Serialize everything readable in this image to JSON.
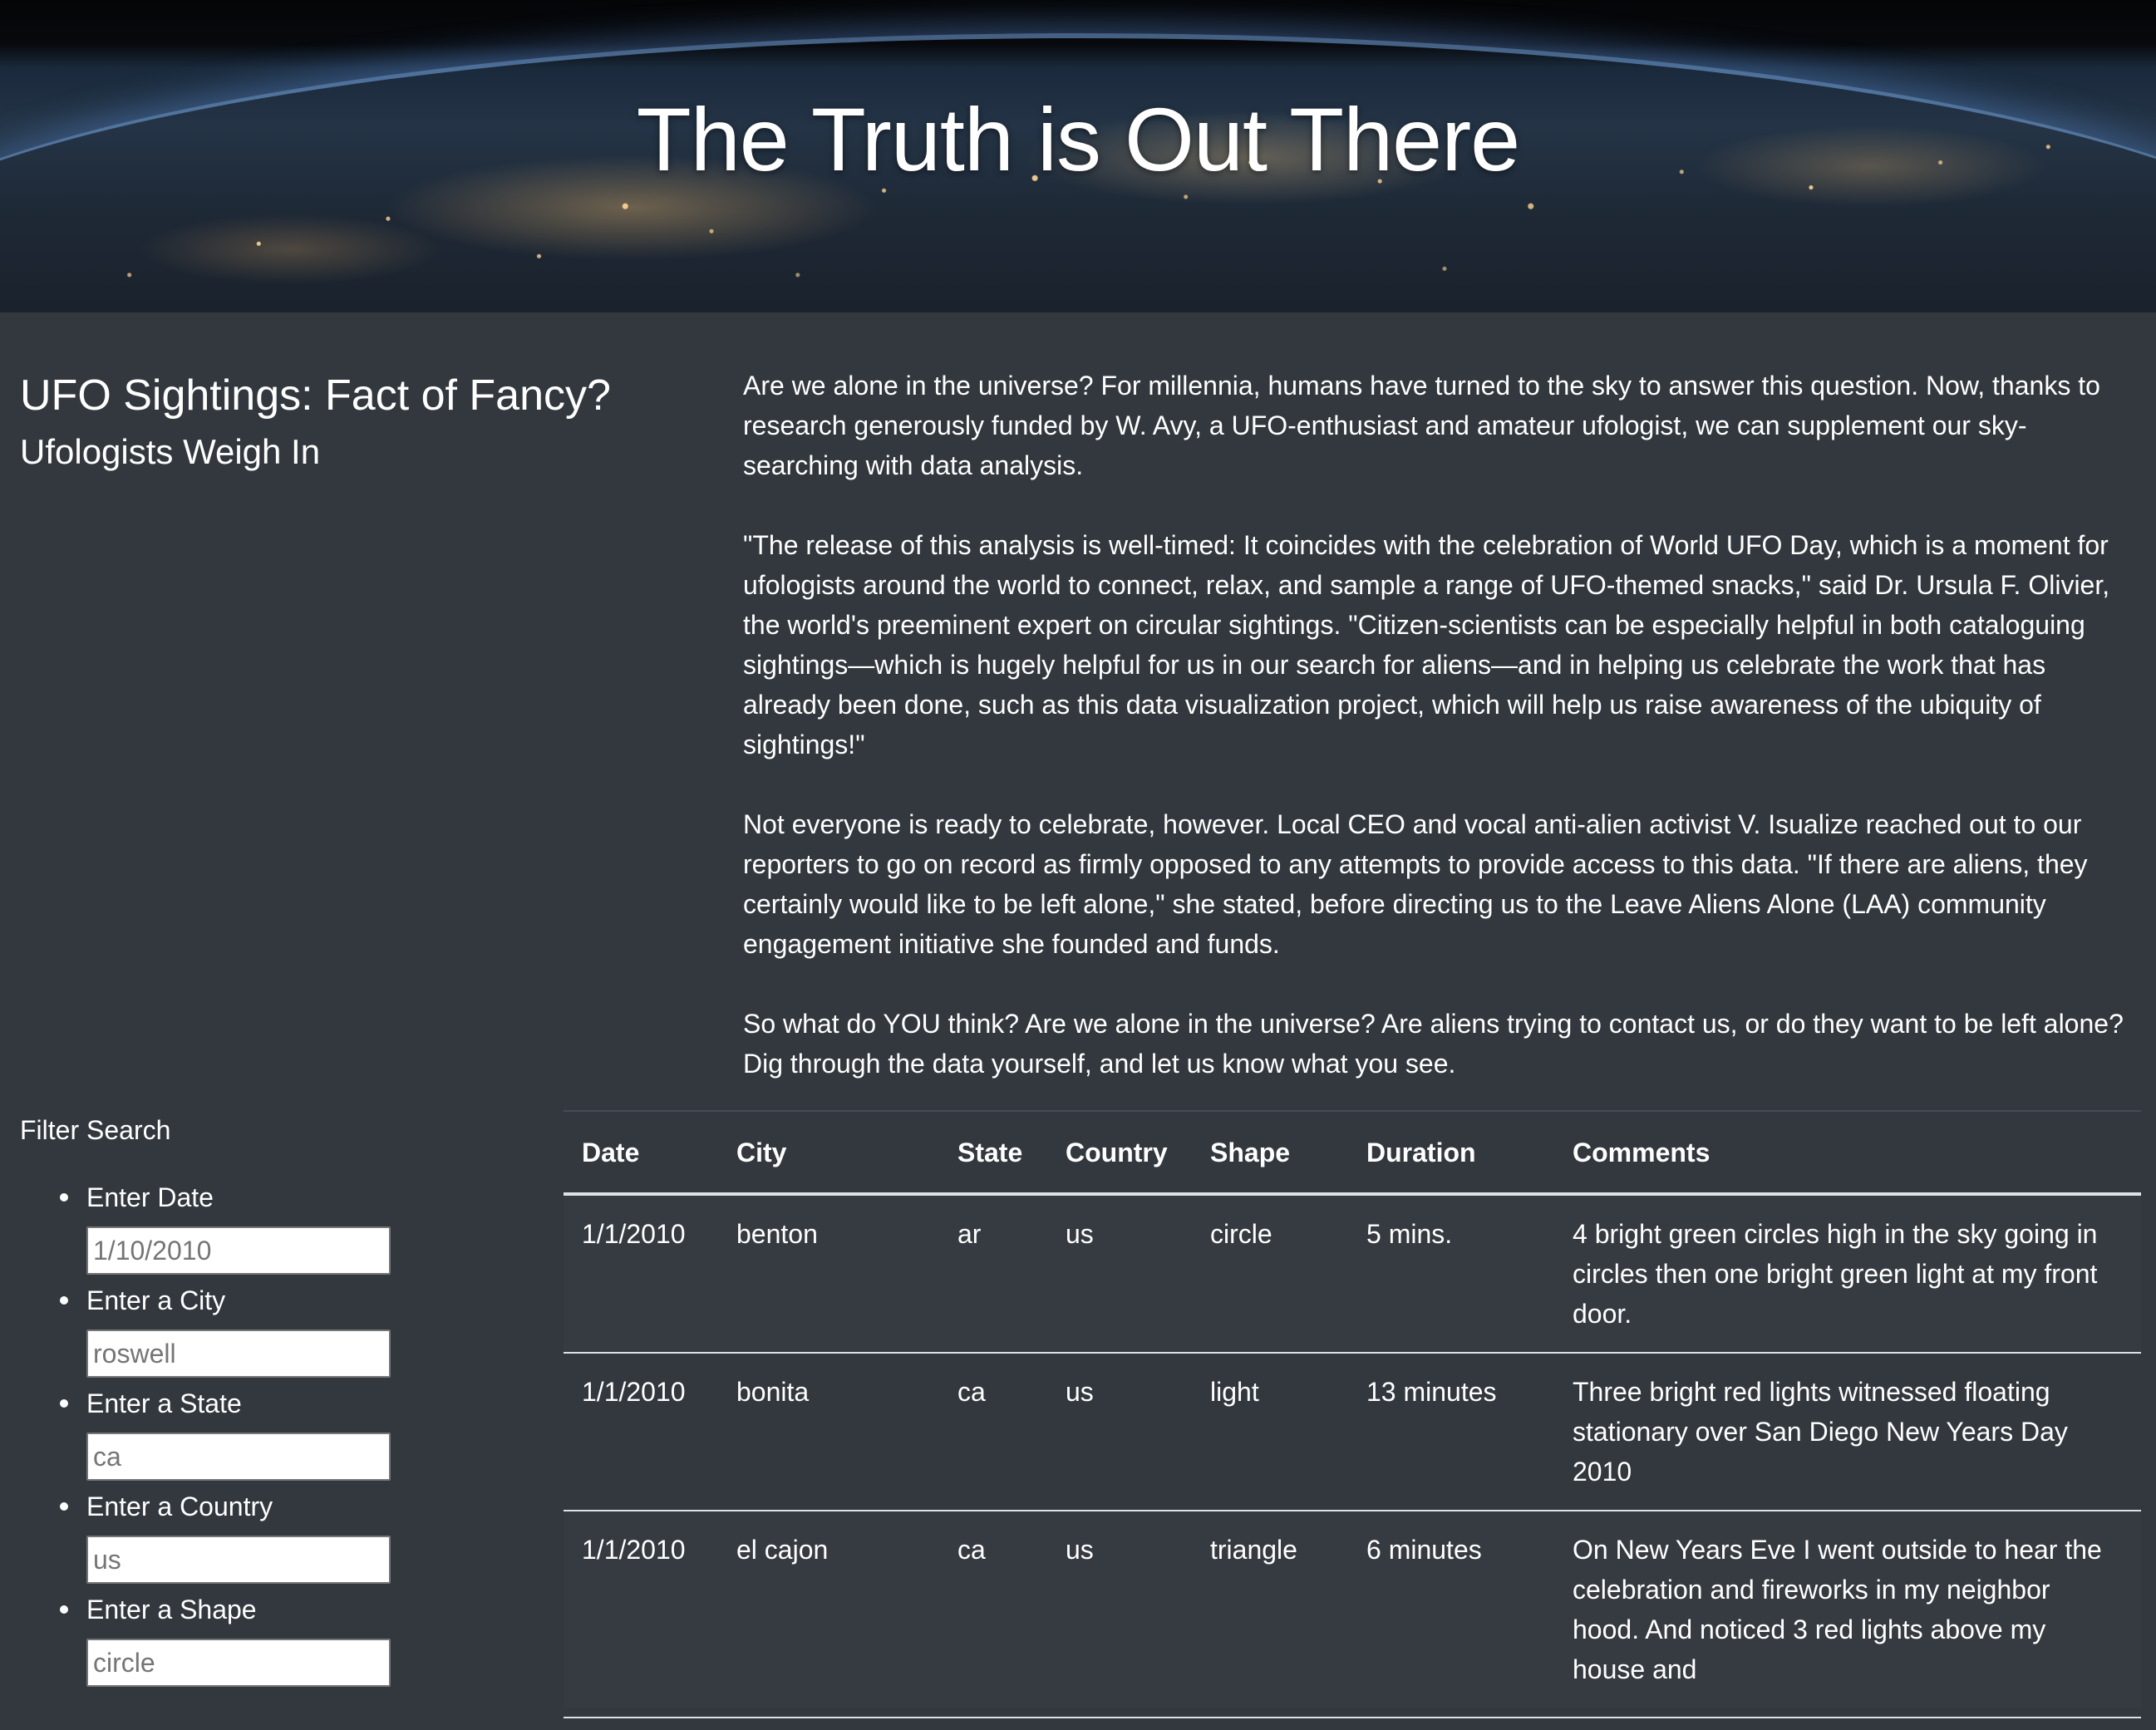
{
  "hero": {
    "title": "The Truth is Out There"
  },
  "intro": {
    "headline": "UFO Sightings: Fact of Fancy?",
    "subheadline": "Ufologists Weigh In"
  },
  "article": {
    "paragraphs": [
      "Are we alone in the universe? For millennia, humans have turned to the sky to answer this question. Now, thanks to research generously funded by W. Avy, a UFO-enthusiast and amateur ufologist, we can supplement our sky-searching with data analysis.",
      "\"The release of this analysis is well-timed: It coincides with the celebration of World UFO Day, which is a moment for ufologists around the world to connect, relax, and sample a range of UFO-themed snacks,\" said Dr. Ursula F. Olivier, the world's preeminent expert on circular sightings. \"Citizen-scientists can be especially helpful in both cataloguing sightings—which is hugely helpful for us in our search for aliens—and in helping us celebrate the work that has already been done, such as this data visualization project, which will help us raise awareness of the ubiquity of sightings!\"",
      "Not everyone is ready to celebrate, however. Local CEO and vocal anti-alien activist V. Isualize reached out to our reporters to go on record as firmly opposed to any attempts to provide access to this data. \"If there are aliens, they certainly would like to be left alone,\" she stated, before directing us to the Leave Aliens Alone (LAA) community engagement initiative she founded and funds.",
      "So what do YOU think? Are we alone in the universe? Are aliens trying to contact us, or do they want to be left alone? Dig through the data yourself, and let us know what you see."
    ]
  },
  "filters": {
    "title": "Filter Search",
    "items": [
      {
        "label": "Enter Date",
        "placeholder": "1/10/2010",
        "value": ""
      },
      {
        "label": "Enter a City",
        "placeholder": "roswell",
        "value": ""
      },
      {
        "label": "Enter a State",
        "placeholder": "ca",
        "value": ""
      },
      {
        "label": "Enter a Country",
        "placeholder": "us",
        "value": ""
      },
      {
        "label": "Enter a Shape",
        "placeholder": "circle",
        "value": ""
      }
    ]
  },
  "table": {
    "columns": [
      "Date",
      "City",
      "State",
      "Country",
      "Shape",
      "Duration",
      "Comments"
    ],
    "rows": [
      [
        "1/1/2010",
        "benton",
        "ar",
        "us",
        "circle",
        "5 mins.",
        "4 bright green circles high in the sky going in circles then one bright green light at my front door."
      ],
      [
        "1/1/2010",
        "bonita",
        "ca",
        "us",
        "light",
        "13 minutes",
        "Three bright red lights witnessed floating stationary over San Diego New Years Day 2010"
      ],
      [
        "1/1/2010",
        "el cajon",
        "ca",
        "us",
        "triangle",
        "6 minutes",
        "On New Years Eve I went outside to hear the celebration and fireworks in my neighbor hood. And noticed 3 red lights above my house and"
      ]
    ]
  },
  "colors": {
    "page_background": "#32383e",
    "text": "#ffffff",
    "table_rule": "#dee2e6"
  }
}
